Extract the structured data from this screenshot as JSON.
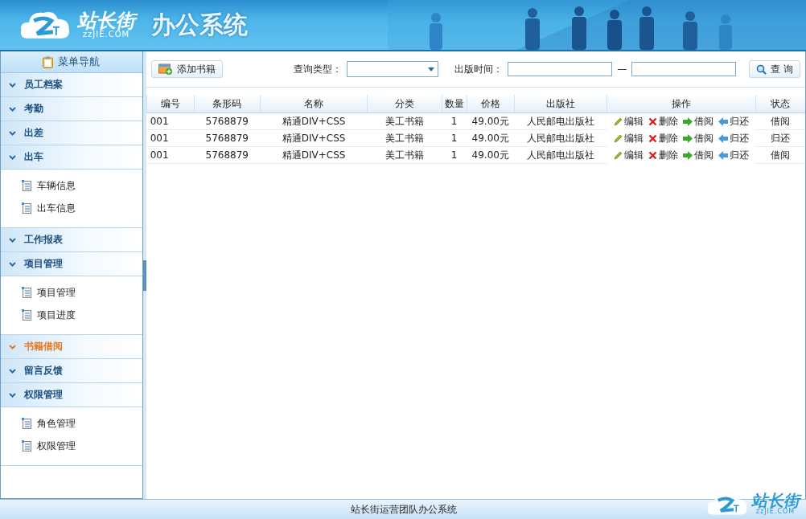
{
  "header": {
    "logo_text": "站长街",
    "logo_domain": "zzJIE.COM",
    "title": "办公系统"
  },
  "sidebar": {
    "title": "菜单导航",
    "groups": [
      {
        "label": "员工档案",
        "selected": false
      },
      {
        "label": "考勤",
        "selected": false
      },
      {
        "label": "出差",
        "selected": false
      },
      {
        "label": "出车",
        "selected": false,
        "children": [
          {
            "label": "车辆信息"
          },
          {
            "label": "出车信息"
          }
        ]
      },
      {
        "label": "工作报表",
        "selected": false
      },
      {
        "label": "项目管理",
        "selected": false,
        "children": [
          {
            "label": "项目管理"
          },
          {
            "label": "项目进度"
          }
        ]
      },
      {
        "label": "书籍借阅",
        "selected": true
      },
      {
        "label": "留言反馈",
        "selected": false
      },
      {
        "label": "权限管理",
        "selected": false,
        "children": [
          {
            "label": "角色管理"
          },
          {
            "label": "权限管理"
          }
        ]
      }
    ]
  },
  "toolbar": {
    "add_button": "添加书籍",
    "query_type_label": "查询类型：",
    "date_label": "出版时间：",
    "date_separator": "—",
    "search_button": "查 询"
  },
  "table": {
    "columns": [
      "编号",
      "条形码",
      "名称",
      "分类",
      "数量",
      "价格",
      "出版社",
      "操作",
      "状态"
    ],
    "rows": [
      {
        "id": "001",
        "barcode": "5768879",
        "name": "精通DIV+CSS",
        "category": "美工书籍",
        "quantity": "1",
        "price": "49.00元",
        "publisher": "人民邮电出版社",
        "actions": [
          {
            "kind": "edit",
            "label": "编辑"
          },
          {
            "kind": "delete",
            "label": "删除"
          },
          {
            "kind": "borrow",
            "label": "借阅"
          },
          {
            "kind": "return",
            "label": "归还"
          }
        ],
        "status": "借阅"
      },
      {
        "id": "001",
        "barcode": "5768879",
        "name": "精通DIV+CSS",
        "category": "美工书籍",
        "quantity": "1",
        "price": "49.00元",
        "publisher": "人民邮电出版社",
        "actions": [
          {
            "kind": "edit",
            "label": "编辑"
          },
          {
            "kind": "delete",
            "label": "删除"
          },
          {
            "kind": "borrow",
            "label": "借阅"
          },
          {
            "kind": "return",
            "label": "归还"
          }
        ],
        "status": "归还"
      },
      {
        "id": "001",
        "barcode": "5768879",
        "name": "精通DIV+CSS",
        "category": "美工书籍",
        "quantity": "1",
        "price": "49.00元",
        "publisher": "人民邮电出版社",
        "actions": [
          {
            "kind": "edit",
            "label": "编辑"
          },
          {
            "kind": "delete",
            "label": "删除"
          },
          {
            "kind": "borrow",
            "label": "借阅"
          },
          {
            "kind": "return",
            "label": "归还"
          }
        ],
        "status": "借阅"
      }
    ]
  },
  "footer": {
    "text": "站长街运营团队办公系统",
    "logo_text": "站长街",
    "logo_domain": "zzJIE.COM"
  }
}
